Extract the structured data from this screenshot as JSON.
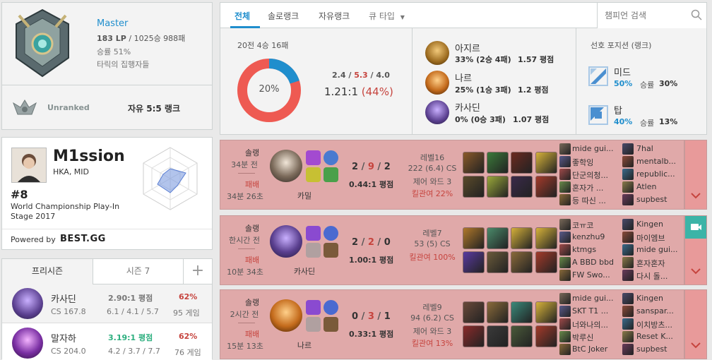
{
  "rank": {
    "tier": "Master",
    "lp_line": "183 LP / 1025승 988패",
    "lp": "183 LP",
    "record": " / 1025승 988패",
    "winrate": "승률 51%",
    "league": "타릭의 집행자들",
    "flex_status": "Unranked",
    "flex_label": "자유 5:5 랭크"
  },
  "tabs": {
    "all": "전체",
    "solo": "솔로랭크",
    "flex": "자유랭크",
    "queue": "큐 타입",
    "search_placeholder": "챔피언 검색"
  },
  "summary": {
    "games": "20전 4승 16패",
    "ratio": "20%",
    "kills": "2.4",
    "deaths": "5.3",
    "assists": "4.0",
    "kda": "1.21:1",
    "kp": "(44%)",
    "winrate_fraction": 0.2
  },
  "top_champs": [
    {
      "name": "아지르",
      "stats": "33% (2승 4패)",
      "kda": "1.57 평점"
    },
    {
      "name": "나르",
      "stats": "25% (1승 3패)",
      "kda": "1.2 평점"
    },
    {
      "name": "카사딘",
      "stats": "0% (0승 3패)",
      "kda": "1.07 평점"
    }
  ],
  "positions": {
    "title": "선호 포지션 (랭크)",
    "items": [
      {
        "name": "미드",
        "pct": "50%",
        "wr_label": "승률",
        "wr": "30%"
      },
      {
        "name": "탑",
        "pct": "40%",
        "wr_label": "승률",
        "wr": "13%"
      }
    ]
  },
  "profile": {
    "name": "M1ssion",
    "team": "HKA, MID",
    "rank": "#8",
    "event": "World Championship Play-In Stage 2017",
    "powered": "Powered by",
    "brand": "BEST.GG"
  },
  "season_tabs": {
    "pre": "프리시즌",
    "s7": "시즌 7",
    "plus": "+"
  },
  "champ_list": [
    {
      "name": "카사딘",
      "cs": "CS 167.8",
      "kda": "2.90:1 평점",
      "kda_detail": "6.1 / 4.1 / 5.7",
      "wr": "62%",
      "games": "95 게임"
    },
    {
      "name": "말자하",
      "cs": "CS 204.0",
      "kda": "3.19:1 평점",
      "kda_detail": "4.2 / 3.7 / 7.7",
      "wr": "62%",
      "games": "76 게임"
    }
  ],
  "games": [
    {
      "type": "솔랭",
      "ago": "34분 전",
      "result": "패배",
      "duration": "34분 26초",
      "champ": "카밀",
      "k": "2",
      "d": "9",
      "a": "2",
      "kda": "0.44:1 평점",
      "level": "레벨16",
      "cs": "222 (6.4) CS",
      "ward": "제어 와드 3",
      "kp": "킬관여 22%",
      "team1": [
        "mide gui...",
        "좋학잉",
        "단군의청...",
        "혼자가 ...",
        "등 따신 ..."
      ],
      "team2": [
        "7hal",
        "mentalb...",
        "republic...",
        "Atlen",
        "supbest"
      ]
    },
    {
      "type": "솔랭",
      "ago": "한시간 전",
      "result": "패배",
      "duration": "10분 34초",
      "champ": "카사딘",
      "k": "2",
      "d": "2",
      "a": "0",
      "kda": "1.00:1 평점",
      "level": "레벨7",
      "cs": "53 (5) CS",
      "ward": "",
      "kp": "킬관여 100%",
      "team1": [
        "코ㅠ코",
        "kenzhu9",
        "ktmgs",
        "A BBD bbd",
        "FW Swo..."
      ],
      "team2": [
        "Kingen",
        "마이엠브",
        "mide gui...",
        "혼자혼자",
        "다시 돌..."
      ]
    },
    {
      "type": "솔랭",
      "ago": "2시간 전",
      "result": "패배",
      "duration": "15분 13초",
      "champ": "나르",
      "k": "0",
      "d": "3",
      "a": "1",
      "kda": "0.33:1 평점",
      "level": "레벨9",
      "cs": "94 (6.2) CS",
      "ward": "제어 와드 3",
      "kp": "킬관여 13%",
      "team1": [
        "mide gui...",
        "SKT T1 ...",
        "너와나의...",
        "박루신",
        "BtC Joker"
      ],
      "team2": [
        "Kingen",
        "sanspar...",
        "이치방츠...",
        "Reset K...",
        "supbest"
      ]
    }
  ]
}
